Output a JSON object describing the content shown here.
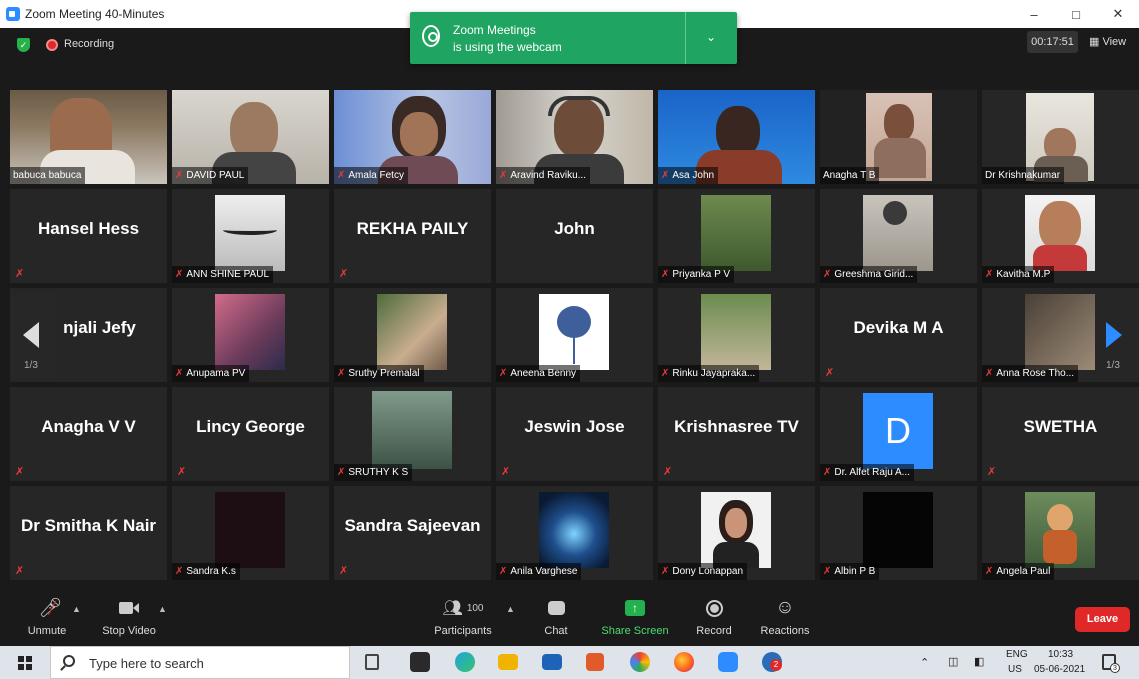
{
  "window": {
    "title": "Zoom Meeting 40-Minutes",
    "controls": [
      "–",
      "□",
      "✕"
    ]
  },
  "topbar": {
    "recording_label": "Recording",
    "timer": "00:17:51",
    "view_label": "View"
  },
  "notification": {
    "line1": "Zoom Meetings",
    "line2": "is using the webcam"
  },
  "pager": {
    "left": "1/3",
    "right": "1/3"
  },
  "row1": [
    {
      "name": "babuca babuca",
      "muted": false
    },
    {
      "name": "DAVID PAUL",
      "muted": true
    },
    {
      "name": "Amala Fetcy",
      "muted": true
    },
    {
      "name": "Aravind Raviku...",
      "muted": true
    },
    {
      "name": "Asa John",
      "muted": true
    },
    {
      "name": "Anagha T B",
      "muted": false
    },
    {
      "name": "Dr Krishnakumar",
      "muted": false
    }
  ],
  "row2": [
    {
      "display": "Hansel Hess"
    },
    {
      "name": "ANN SHINE PAUL"
    },
    {
      "display": "REKHA PAILY"
    },
    {
      "display": "John"
    },
    {
      "name": "Priyanka P V"
    },
    {
      "name": "Greeshma Girid..."
    },
    {
      "name": "Kavitha M.P"
    }
  ],
  "row3": [
    {
      "display": "njali  Jefy"
    },
    {
      "name": "Anupama PV"
    },
    {
      "name": "Sruthy Premalal"
    },
    {
      "name": "Aneena Benny"
    },
    {
      "name": "Rinku Jayapraka..."
    },
    {
      "display": "Devika M A"
    },
    {
      "name": "Anna Rose Tho..."
    }
  ],
  "row4": [
    {
      "display": "Anagha V V"
    },
    {
      "display": "Lincy George"
    },
    {
      "name": "SRUTHY K S"
    },
    {
      "display": "Jeswin Jose"
    },
    {
      "display": "Krishnasree TV"
    },
    {
      "name": "Dr. Alfet Raju A...",
      "initial": "D"
    },
    {
      "display": "SWETHA"
    }
  ],
  "row5": [
    {
      "display": "Dr Smitha K Nair"
    },
    {
      "name": "Sandra K.s"
    },
    {
      "display": "Sandra Sajeevan"
    },
    {
      "name": "Anila Varghese"
    },
    {
      "name": "Dony Lonappan"
    },
    {
      "name": "Albin P B"
    },
    {
      "name": "Angela Paul"
    }
  ],
  "toolbar": {
    "unmute": "Unmute",
    "stop_video": "Stop Video",
    "participants": "Participants",
    "participants_count": "100",
    "chat": "Chat",
    "share_screen": "Share Screen",
    "record": "Record",
    "reactions": "Reactions",
    "leave": "Leave"
  },
  "taskbar": {
    "search_placeholder": "Type here to search",
    "lang1": "ENG",
    "lang2": "US",
    "time": "10:33",
    "date": "05-06-2021",
    "badge": "2",
    "notif_count": "3"
  },
  "colors": {
    "active_speaker": "#cfe86a",
    "share_green": "#22b14c",
    "leave_red": "#e02828",
    "zoom_blue": "#2d8cff",
    "notification_green": "#1fa462"
  }
}
